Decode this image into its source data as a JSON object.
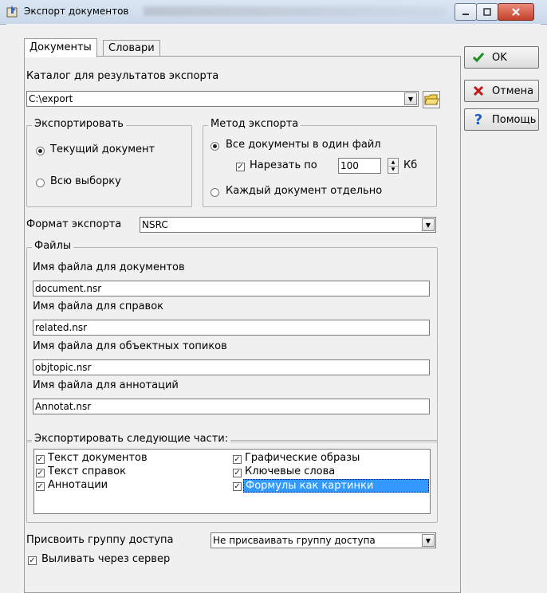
{
  "window": {
    "title": "Экспорт документов"
  },
  "tabs": [
    {
      "label": "Документы"
    },
    {
      "label": "Словари"
    }
  ],
  "catalog": {
    "label": "Каталог для результатов экспорта",
    "value": "C:\\export"
  },
  "export_group": {
    "title": "Экспортировать",
    "options": [
      "Текущий документ",
      "Всю выборку"
    ],
    "selected": 0
  },
  "method_group": {
    "title": "Метод экспорта",
    "option_all": "Все документы в один файл",
    "split_label": "Нарезать по",
    "split_value": "100",
    "split_unit": "Кб",
    "option_each": "Каждый документ отдельно"
  },
  "format": {
    "label": "Формат экспорта",
    "value": "NSRC"
  },
  "files_group": {
    "title": "Файлы",
    "fields": [
      {
        "label": "Имя файла для документов",
        "value": "document.nsr"
      },
      {
        "label": "Имя файла для справок",
        "value": "related.nsr"
      },
      {
        "label": "Имя файла для объектных топиков",
        "value": "objtopic.nsr"
      },
      {
        "label": "Имя файла для аннотаций",
        "value": "Annotat.nsr"
      }
    ]
  },
  "parts_group": {
    "title": "Экспортировать следующие части:",
    "left": [
      "Текст документов",
      "Текст справок",
      "Аннотации"
    ],
    "right": [
      "Графические образы",
      "Ключевые слова",
      "Формулы как картинки"
    ]
  },
  "access": {
    "label": "Присвоить группу доступа",
    "value": "Не присваивать группу доступа"
  },
  "server": {
    "label": "Выливать через сервер"
  },
  "buttons": {
    "ok": "OK",
    "cancel": "Отмена",
    "help": "Помощь"
  },
  "colors": {
    "selection": "#3399ff",
    "ok_check": "#1a8f1a",
    "cancel_x": "#c01818",
    "help_q": "#1f5fbf"
  }
}
